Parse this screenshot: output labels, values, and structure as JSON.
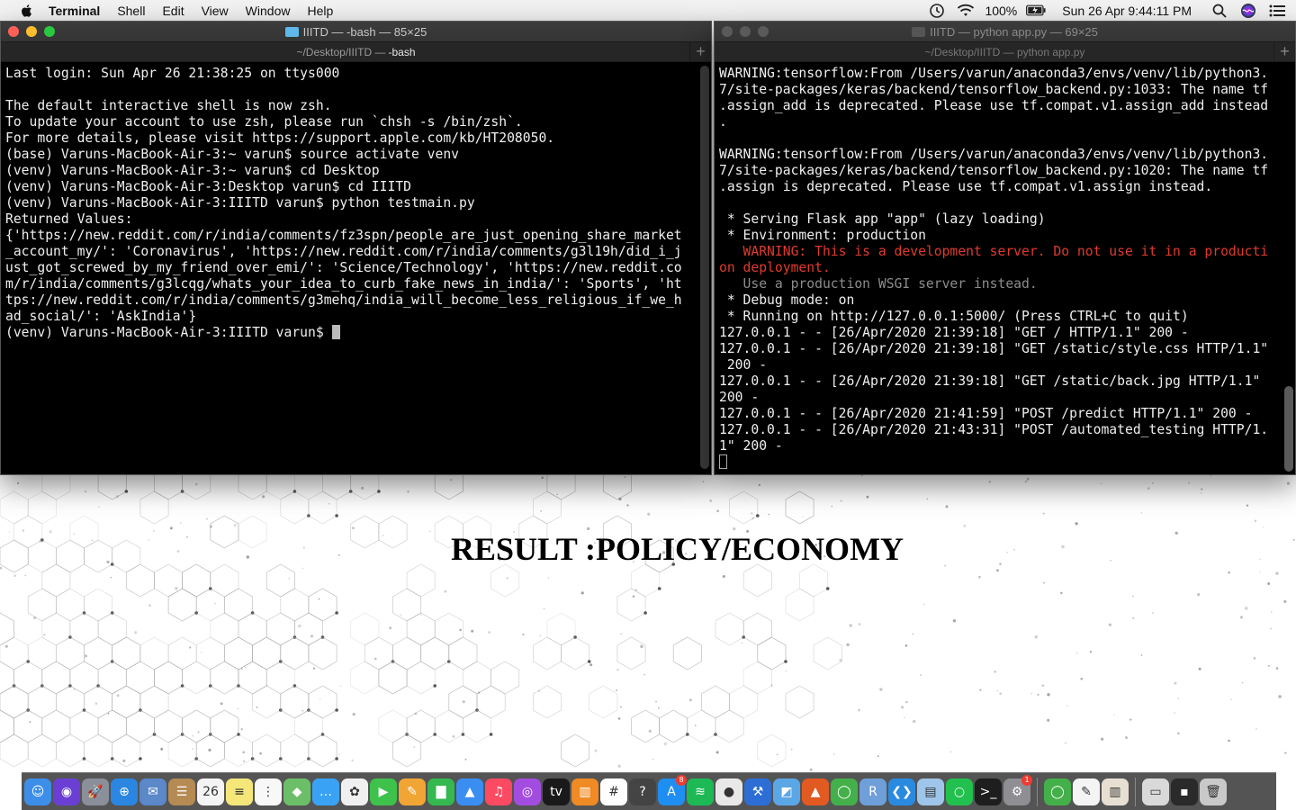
{
  "menubar": {
    "items": [
      "Terminal",
      "Shell",
      "Edit",
      "View",
      "Window",
      "Help"
    ],
    "battery": "100%",
    "clock": "Sun 26 Apr  9:44:11 PM"
  },
  "left_window": {
    "title": "IIITD — -bash — 85×25",
    "tab_path": "~/Desktop/IIITD — ",
    "tab_bold": "-bash",
    "lines": [
      "Last login: Sun Apr 26 21:38:25 on ttys000",
      "",
      "The default interactive shell is now zsh.",
      "To update your account to use zsh, please run `chsh -s /bin/zsh`.",
      "For more details, please visit https://support.apple.com/kb/HT208050.",
      "(base) Varuns-MacBook-Air-3:~ varun$ source activate venv",
      "(venv) Varuns-MacBook-Air-3:~ varun$ cd Desktop",
      "(venv) Varuns-MacBook-Air-3:Desktop varun$ cd IIITD",
      "(venv) Varuns-MacBook-Air-3:IIITD varun$ python testmain.py",
      "Returned Values:",
      "{'https://new.reddit.com/r/india/comments/fz3spn/people_are_just_opening_share_market",
      "_account_my/': 'Coronavirus', 'https://new.reddit.com/r/india/comments/g3l19h/did_i_j",
      "ust_got_screwed_by_my_friend_over_emi/': 'Science/Technology', 'https://new.reddit.co",
      "m/r/india/comments/g3lcqg/whats_your_idea_to_curb_fake_news_in_india/': 'Sports', 'ht",
      "tps://new.reddit.com/r/india/comments/g3mehq/india_will_become_less_religious_if_we_h",
      "ad_social/': 'AskIndia'}"
    ],
    "prompt": "(venv) Varuns-MacBook-Air-3:IIITD varun$ "
  },
  "right_window": {
    "title": "IIITD — python app.py — 69×25",
    "tab_path": "~/Desktop/IIITD — python app.py",
    "lines": [
      {
        "t": "WARNING:tensorflow:From /Users/varun/anaconda3/envs/venv/lib/python3.",
        "s": "n"
      },
      {
        "t": "7/site-packages/keras/backend/tensorflow_backend.py:1033: The name tf",
        "s": "n"
      },
      {
        "t": ".assign_add is deprecated. Please use tf.compat.v1.assign_add instead",
        "s": "n"
      },
      {
        "t": ".",
        "s": "n"
      },
      {
        "t": "",
        "s": "n"
      },
      {
        "t": "WARNING:tensorflow:From /Users/varun/anaconda3/envs/venv/lib/python3.",
        "s": "n"
      },
      {
        "t": "7/site-packages/keras/backend/tensorflow_backend.py:1020: The name tf",
        "s": "n"
      },
      {
        "t": ".assign is deprecated. Please use tf.compat.v1.assign instead.",
        "s": "n"
      },
      {
        "t": "",
        "s": "n"
      },
      {
        "t": " * Serving Flask app \"app\" (lazy loading)",
        "s": "n"
      },
      {
        "t": " * Environment: production",
        "s": "n"
      },
      {
        "t": "   WARNING: This is a development server. Do not use it in a producti",
        "s": "w"
      },
      {
        "t": "on deployment.",
        "s": "w"
      },
      {
        "t": "   Use a production WSGI server instead.",
        "s": "d"
      },
      {
        "t": " * Debug mode: on",
        "s": "n"
      },
      {
        "t": " * Running on http://127.0.0.1:5000/ (Press CTRL+C to quit)",
        "s": "n"
      },
      {
        "t": "127.0.0.1 - - [26/Apr/2020 21:39:18] \"GET / HTTP/1.1\" 200 -",
        "s": "n"
      },
      {
        "t": "127.0.0.1 - - [26/Apr/2020 21:39:18] \"GET /static/style.css HTTP/1.1\"",
        "s": "n"
      },
      {
        "t": " 200 -",
        "s": "n"
      },
      {
        "t": "127.0.0.1 - - [26/Apr/2020 21:39:18] \"GET /static/back.jpg HTTP/1.1\"",
        "s": "n"
      },
      {
        "t": "200 -",
        "s": "n"
      },
      {
        "t": "127.0.0.1 - - [26/Apr/2020 21:41:59] \"POST /predict HTTP/1.1\" 200 -",
        "s": "n"
      },
      {
        "t": "127.0.0.1 - - [26/Apr/2020 21:43:31] \"POST /automated_testing HTTP/1.",
        "s": "n"
      },
      {
        "t": "1\" 200 -",
        "s": "n"
      }
    ]
  },
  "webpage": {
    "result": "RESULT :POLICY/ECONOMY"
  },
  "dock": {
    "apps": [
      {
        "name": "finder",
        "color": "#3d8ee8",
        "glyph": "☺"
      },
      {
        "name": "siri",
        "color": "#6b3fd4",
        "glyph": "◉"
      },
      {
        "name": "launchpad",
        "color": "#8a8f99",
        "glyph": "🚀"
      },
      {
        "name": "safari",
        "color": "#2a86e0",
        "glyph": "⊕"
      },
      {
        "name": "mail",
        "color": "#5a88c8",
        "glyph": "✉"
      },
      {
        "name": "contacts",
        "color": "#b58a53",
        "glyph": "☰"
      },
      {
        "name": "calendar",
        "color": "#f4f4f4",
        "glyph": "26"
      },
      {
        "name": "notes",
        "color": "#f5e67a",
        "glyph": "≡"
      },
      {
        "name": "reminders",
        "color": "#f8f8f8",
        "glyph": "⋮"
      },
      {
        "name": "maps",
        "color": "#6cbf68",
        "glyph": "◆"
      },
      {
        "name": "messages-2",
        "color": "#3aa2f5",
        "glyph": "…"
      },
      {
        "name": "photos",
        "color": "#f0f0f0",
        "glyph": "✿"
      },
      {
        "name": "facetime",
        "color": "#3ec24b",
        "glyph": "▶"
      },
      {
        "name": "pages",
        "color": "#f1a534",
        "glyph": "✎"
      },
      {
        "name": "numbers",
        "color": "#34b84f",
        "glyph": "▇"
      },
      {
        "name": "keynote",
        "color": "#3a8ef2",
        "glyph": "▲"
      },
      {
        "name": "music",
        "color": "#fb4a61",
        "glyph": "♫"
      },
      {
        "name": "podcasts",
        "color": "#a34ce0",
        "glyph": "◎"
      },
      {
        "name": "apple-tv",
        "color": "#1a1a1a",
        "glyph": "tv"
      },
      {
        "name": "books",
        "color": "#f08a24",
        "glyph": "▥"
      },
      {
        "name": "slack",
        "color": "#ffffff",
        "glyph": "#"
      },
      {
        "name": "help",
        "color": "#444444",
        "glyph": "?"
      },
      {
        "name": "app-store",
        "color": "#1f8ef2",
        "glyph": "A",
        "badge": "8"
      },
      {
        "name": "spotify",
        "color": "#1db954",
        "glyph": "≋"
      },
      {
        "name": "chrome",
        "color": "#e8e8e8",
        "glyph": "●"
      },
      {
        "name": "xcode",
        "color": "#2c6ed4",
        "glyph": "⚒"
      },
      {
        "name": "preview",
        "color": "#5ba7e6",
        "glyph": "◩"
      },
      {
        "name": "matlab",
        "color": "#e15a22",
        "glyph": "▲"
      },
      {
        "name": "anaconda",
        "color": "#43b049",
        "glyph": "◯"
      },
      {
        "name": "r-studio",
        "color": "#6f9fd8",
        "glyph": "R"
      },
      {
        "name": "vscode",
        "color": "#2a8ae0",
        "glyph": "❮❯"
      },
      {
        "name": "preview-2",
        "color": "#9fc6ea",
        "glyph": "▤"
      },
      {
        "name": "activity",
        "color": "#22c04f",
        "glyph": "○"
      },
      {
        "name": "terminal",
        "color": "#1e1e1e",
        "glyph": ">_"
      },
      {
        "name": "system-prefs",
        "color": "#8e8e93",
        "glyph": "⚙",
        "badge": "1"
      }
    ],
    "recent": [
      {
        "name": "anaconda-2",
        "color": "#43b049",
        "glyph": "◯"
      },
      {
        "name": "textedit",
        "color": "#f4f4f4",
        "glyph": "✎"
      },
      {
        "name": "archive",
        "color": "#e7e0d2",
        "glyph": "▥"
      }
    ],
    "trash": [
      {
        "name": "chrome-window",
        "color": "#d9d9d9",
        "glyph": "▭"
      },
      {
        "name": "terminal-window",
        "color": "#2a2a2a",
        "glyph": "▪"
      },
      {
        "name": "trash",
        "color": "#c9c9c9",
        "glyph": "🗑"
      }
    ]
  }
}
